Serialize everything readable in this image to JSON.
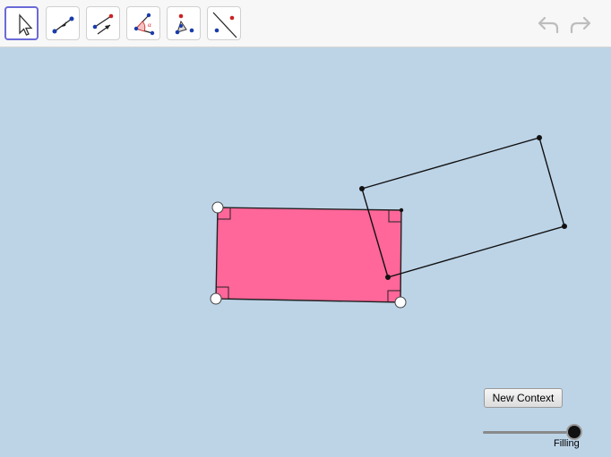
{
  "toolbar": {
    "tools": [
      {
        "name": "move-tool",
        "selected": true
      },
      {
        "name": "segment-tool",
        "selected": false
      },
      {
        "name": "vector-tool",
        "selected": false
      },
      {
        "name": "angle-tool",
        "selected": false
      },
      {
        "name": "polygon-tool",
        "selected": false
      },
      {
        "name": "line-point-tool",
        "selected": false
      }
    ],
    "undo_icon": "undo-icon",
    "redo_icon": "redo-icon"
  },
  "canvas": {
    "filled_rectangle_color": "#ff6699",
    "outline_color": "#000000"
  },
  "controls": {
    "new_context_label": "New Context",
    "slider_label": "Filling",
    "slider_value": 1.0
  }
}
